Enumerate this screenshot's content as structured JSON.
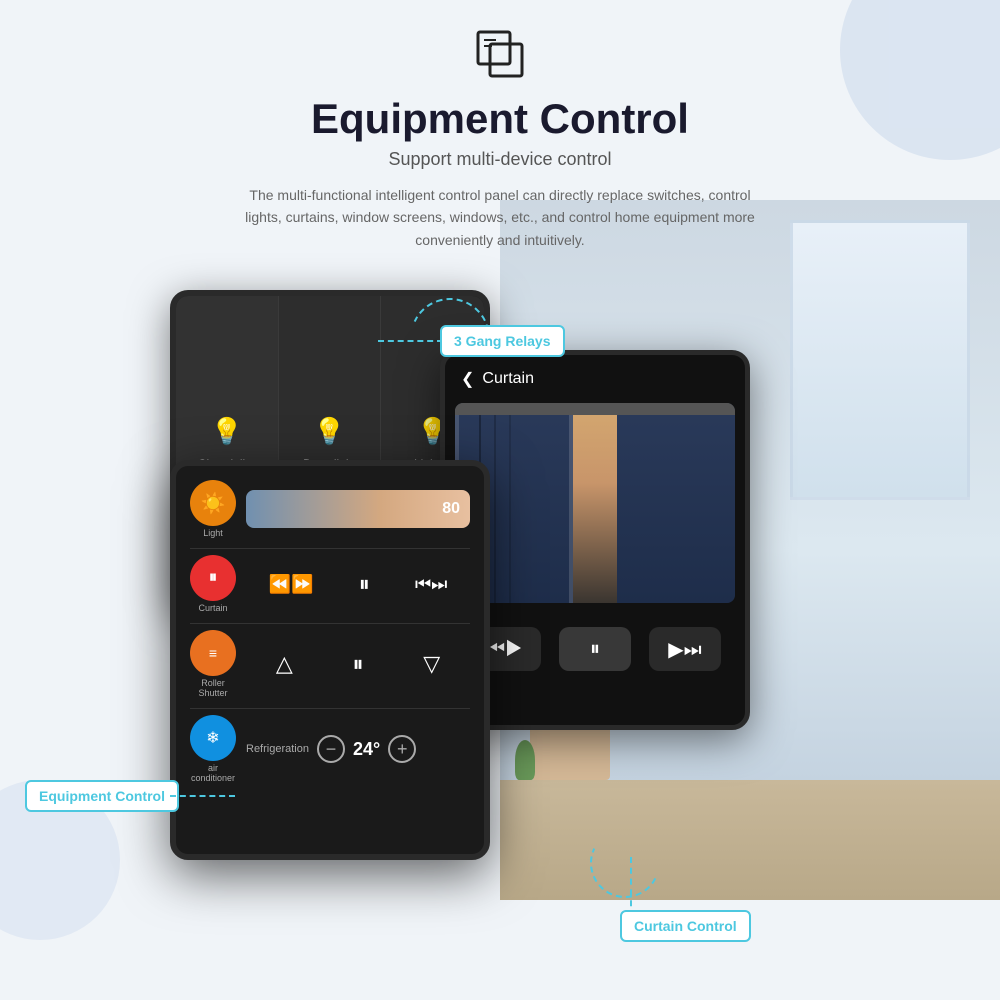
{
  "header": {
    "title": "Equipment Control",
    "subtitle": "Support multi-device control",
    "description": "The multi-functional intelligent control panel can directly replace switches, control lights, curtains, window screens, windows, etc., and control home equipment more conveniently and intuitively."
  },
  "labels": {
    "three_gang": "3 Gang Relays",
    "equipment_control": "Equipment Control",
    "curtain_control": "Curtain Control"
  },
  "light_panel": {
    "columns": [
      {
        "name": "Chandelier"
      },
      {
        "name": "Downlight"
      },
      {
        "name": "Light S"
      }
    ]
  },
  "curtain_panel": {
    "back_label": "Curtain",
    "controls": [
      "◀▶",
      "⏸",
      "▶⏮"
    ]
  },
  "equipment_panel": {
    "rows": [
      {
        "icon": "☀",
        "label": "Light",
        "type": "slider",
        "value": "80"
      },
      {
        "icon": "▣",
        "label": "Curtain",
        "type": "curtain",
        "controls": [
          "⏪⏩",
          "⏸",
          "⏭⏮"
        ]
      },
      {
        "icon": "≡",
        "label": "Roller Shutter",
        "type": "shutter",
        "controls": [
          "△",
          "⏸",
          "▽"
        ]
      },
      {
        "icon": "❄",
        "label": "air conditioner",
        "sublabel": "Refrigeration",
        "type": "ac",
        "temp": "24°"
      }
    ]
  },
  "colors": {
    "accent": "#4dc8e0",
    "bg": "#f0f4f8",
    "device_bg": "#1a1a1a",
    "icon_orange": "#e8820c",
    "icon_red": "#e83030",
    "icon_lines": "#e87020",
    "icon_ac": "#1090e0"
  }
}
